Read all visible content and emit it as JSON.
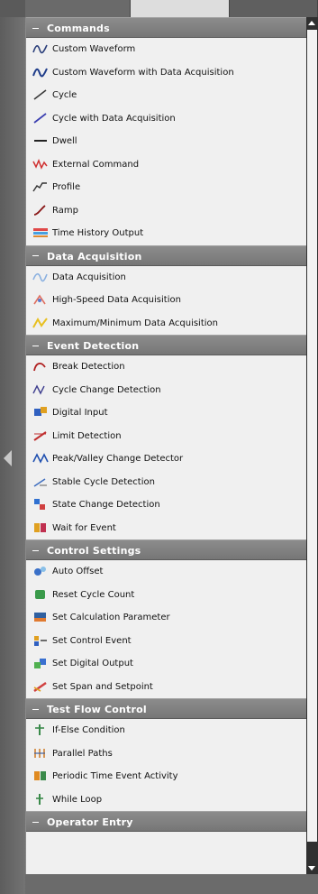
{
  "sections": [
    {
      "title": "Commands",
      "items": [
        {
          "label": "Custom Waveform",
          "icon": "custom-waveform-icon"
        },
        {
          "label": "Custom Waveform with Data Acquisition",
          "icon": "custom-waveform-daq-icon"
        },
        {
          "label": "Cycle",
          "icon": "cycle-icon"
        },
        {
          "label": "Cycle with Data Acquisition",
          "icon": "cycle-daq-icon"
        },
        {
          "label": "Dwell",
          "icon": "dwell-icon"
        },
        {
          "label": "External Command",
          "icon": "external-command-icon"
        },
        {
          "label": "Profile",
          "icon": "profile-icon"
        },
        {
          "label": "Ramp",
          "icon": "ramp-icon"
        },
        {
          "label": "Time History Output",
          "icon": "time-history-output-icon"
        }
      ]
    },
    {
      "title": "Data Acquisition",
      "items": [
        {
          "label": "Data Acquisition",
          "icon": "data-acquisition-icon"
        },
        {
          "label": "High-Speed Data Acquisition",
          "icon": "high-speed-data-acquisition-icon"
        },
        {
          "label": "Maximum/Minimum Data Acquisition",
          "icon": "max-min-data-acquisition-icon"
        }
      ]
    },
    {
      "title": "Event Detection",
      "items": [
        {
          "label": "Break Detection",
          "icon": "break-detection-icon"
        },
        {
          "label": "Cycle Change Detection",
          "icon": "cycle-change-detection-icon"
        },
        {
          "label": "Digital Input",
          "icon": "digital-input-icon"
        },
        {
          "label": "Limit Detection",
          "icon": "limit-detection-icon"
        },
        {
          "label": "Peak/Valley Change Detector",
          "icon": "peak-valley-icon"
        },
        {
          "label": "Stable Cycle Detection",
          "icon": "stable-cycle-icon"
        },
        {
          "label": "State Change Detection",
          "icon": "state-change-icon"
        },
        {
          "label": "Wait for Event",
          "icon": "wait-for-event-icon"
        }
      ]
    },
    {
      "title": "Control Settings",
      "items": [
        {
          "label": "Auto Offset",
          "icon": "auto-offset-icon"
        },
        {
          "label": "Reset Cycle Count",
          "icon": "reset-cycle-count-icon"
        },
        {
          "label": "Set Calculation Parameter",
          "icon": "set-calculation-parameter-icon"
        },
        {
          "label": "Set Control Event",
          "icon": "set-control-event-icon"
        },
        {
          "label": "Set Digital Output",
          "icon": "set-digital-output-icon"
        },
        {
          "label": "Set Span and Setpoint",
          "icon": "set-span-setpoint-icon"
        }
      ]
    },
    {
      "title": "Test Flow Control",
      "items": [
        {
          "label": "If-Else Condition",
          "icon": "if-else-icon"
        },
        {
          "label": "Parallel Paths",
          "icon": "parallel-paths-icon"
        },
        {
          "label": "Periodic Time Event Activity",
          "icon": "periodic-time-event-icon"
        },
        {
          "label": "While Loop",
          "icon": "while-loop-icon"
        }
      ]
    },
    {
      "title": "Operator Entry",
      "items": []
    }
  ],
  "colors": {
    "header_bg": "#7f7f7f",
    "panel_bg": "#f0f0f0",
    "frame_bg": "#6f6f6f"
  }
}
